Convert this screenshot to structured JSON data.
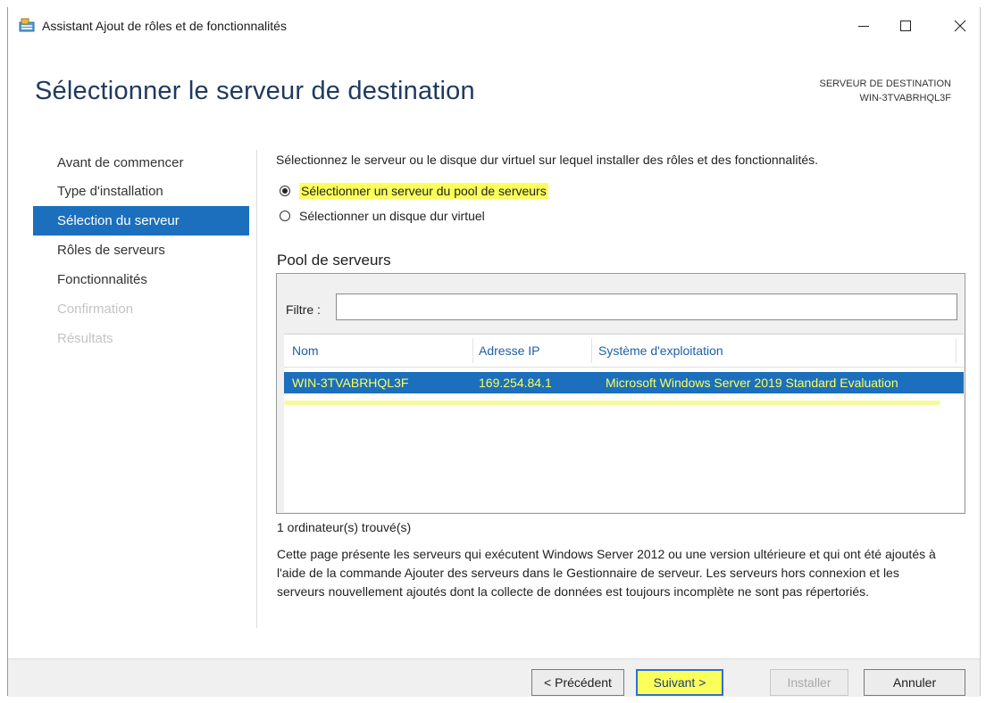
{
  "window": {
    "title": "Assistant Ajout de rôles et de fonctionnalités"
  },
  "header": {
    "page_title": "Sélectionner le serveur de destination",
    "destination_label": "SERVEUR DE DESTINATION",
    "destination_server": "WIN-3TVABRHQL3F"
  },
  "steps": [
    {
      "label": "Avant de commencer",
      "state": "normal"
    },
    {
      "label": "Type d'installation",
      "state": "normal"
    },
    {
      "label": "Sélection du serveur",
      "state": "active"
    },
    {
      "label": "Rôles de serveurs",
      "state": "normal"
    },
    {
      "label": "Fonctionnalités",
      "state": "normal"
    },
    {
      "label": "Confirmation",
      "state": "disabled"
    },
    {
      "label": "Résultats",
      "state": "disabled"
    }
  ],
  "main": {
    "instruction": "Sélectionnez le serveur ou le disque dur virtuel sur lequel installer des rôles et des fonctionnalités.",
    "options": [
      {
        "label": "Sélectionner un serveur du pool de serveurs",
        "checked": true
      },
      {
        "label": "Sélectionner un disque dur virtuel",
        "checked": false
      }
    ],
    "pool_title": "Pool de serveurs",
    "filter_label": "Filtre :",
    "filter_value": "",
    "columns": [
      "Nom",
      "Adresse IP",
      "Système d'exploitation"
    ],
    "rows": [
      {
        "name": "WIN-3TVABRHQL3F",
        "ip": "169.254.84.1",
        "os": "Microsoft Windows Server 2019 Standard Evaluation"
      }
    ],
    "found_text": "1 ordinateur(s) trouvé(s)",
    "description": "Cette page présente les serveurs qui exécutent Windows Server 2012 ou une version ultérieure et qui ont été ajoutés à l'aide de la commande Ajouter des serveurs dans le Gestionnaire de serveur. Les serveurs hors connexion et les serveurs nouvellement ajoutés dont la collecte de données est toujours incomplète ne sont pas répertoriés."
  },
  "footer": {
    "previous_label": "< Précédent",
    "next_label": "Suivant >",
    "install_label": "Installer",
    "cancel_label": "Annuler"
  },
  "colors": {
    "accent_blue": "#1b6fbd",
    "title_blue": "#1f3a60",
    "highlight_yellow": "#fbff5a"
  }
}
